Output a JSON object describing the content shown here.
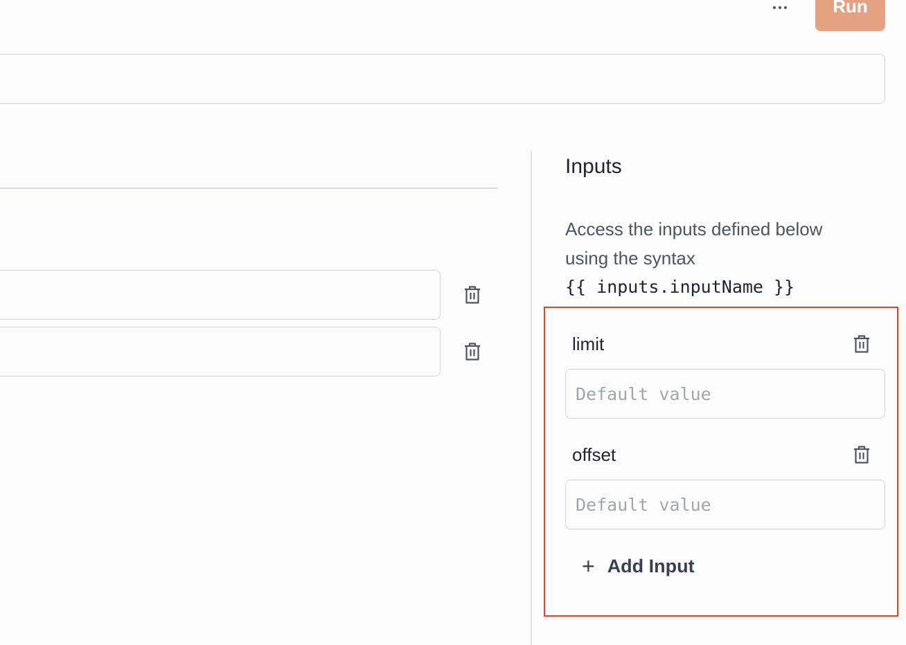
{
  "toolbar": {
    "more_icon": "ellipsis-horizontal-icon",
    "run_label": "Run",
    "run_color": "#e4a283"
  },
  "inputs_panel": {
    "title": "Inputs",
    "description": "Access the inputs defined below using the syntax",
    "syntax": "{{ inputs.inputName }}",
    "items": [
      {
        "name": "limit",
        "value": "",
        "placeholder": "Default value"
      },
      {
        "name": "offset",
        "value": "",
        "placeholder": "Default value"
      }
    ],
    "add_label": "Add Input",
    "highlight_color": "#e0442b"
  },
  "icons": {
    "delete": "trash-icon",
    "add": "plus-icon"
  }
}
